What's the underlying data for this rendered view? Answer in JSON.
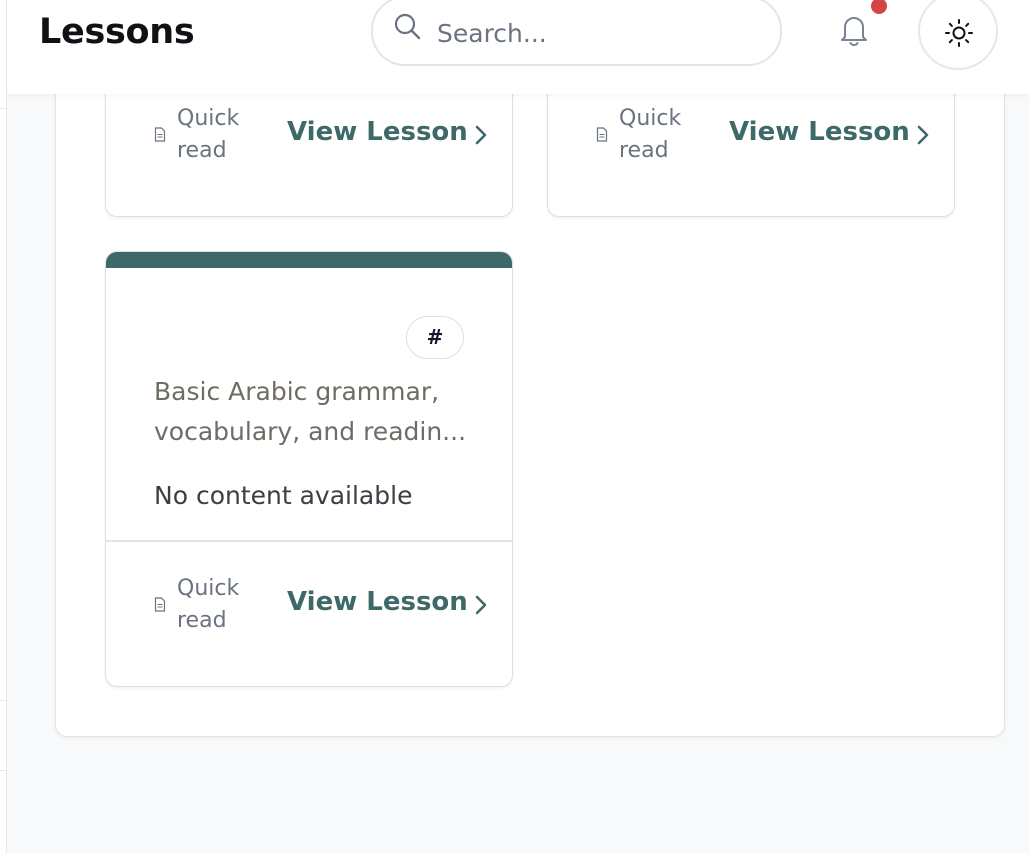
{
  "header": {
    "title": "Lessons",
    "search_placeholder": "Search...",
    "search_icon": "search-icon",
    "notifications_icon": "bell-icon",
    "notification_badge_color": "#d64545",
    "theme_toggle_icon": "sun-icon"
  },
  "colors": {
    "accent": "#3e6969",
    "description_text": "#706c64"
  },
  "lessons": [
    {
      "reading_time": "Quick read",
      "action_label": "View Lesson"
    },
    {
      "reading_time": "Quick read",
      "action_label": "View Lesson"
    },
    {
      "tag": "#",
      "description": "Basic Arabic grammar, vocabulary, and readin...",
      "content_status": "No content available",
      "reading_time": "Quick read",
      "action_label": "View Lesson"
    }
  ]
}
